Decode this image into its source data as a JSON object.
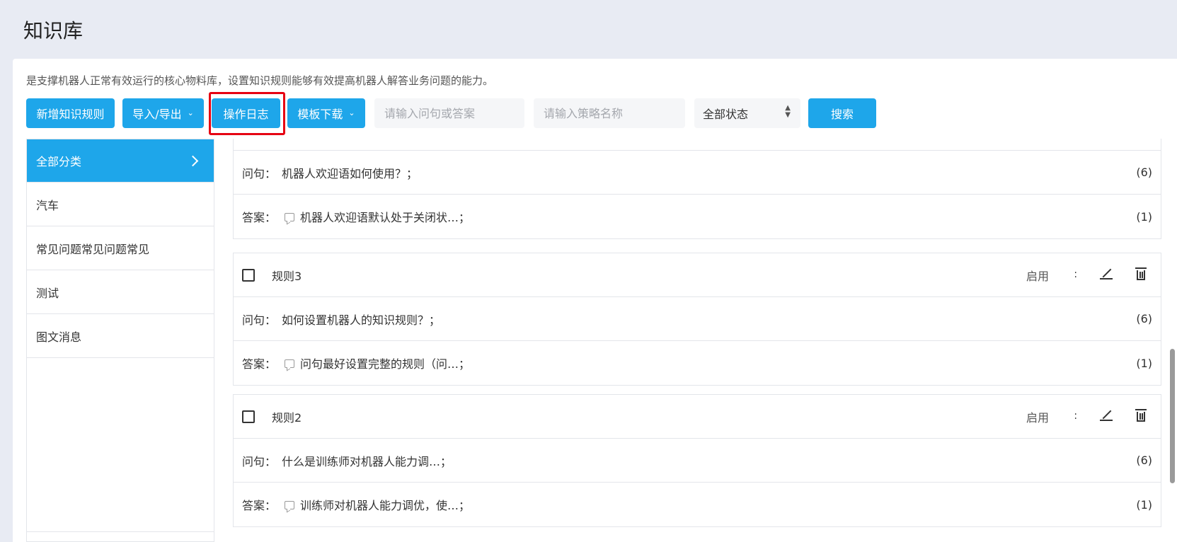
{
  "page": {
    "title": "知识库",
    "description": "是支撑机器人正常有效运行的核心物料库，设置知识规则能够有效提高机器人解答业务问题的能力。"
  },
  "toolbar": {
    "add_rule": "新增知识规则",
    "import_export": "导入/导出",
    "op_log": "操作日志",
    "template_download": "模板下载",
    "search_question_placeholder": "请输入问句或答案",
    "search_strategy_placeholder": "请输入策略名称",
    "status_select": "全部状态",
    "search": "搜索"
  },
  "sidebar": {
    "items": [
      {
        "label": "全部分类"
      },
      {
        "label": "汽车"
      },
      {
        "label": "常见问题常见问题常见"
      },
      {
        "label": "测试"
      },
      {
        "label": "图文消息"
      }
    ]
  },
  "labels": {
    "question": "问句：",
    "answer": "答案："
  },
  "rules": [
    {
      "name": "",
      "question": "机器人欢迎语如何使用？；",
      "question_count": "(6)",
      "answer": "机器人欢迎语默认处于关闭状…；",
      "answer_count": "(1)"
    },
    {
      "name": "规则3",
      "status": "启用",
      "question": "如何设置机器人的知识规则？；",
      "question_count": "(6)",
      "answer": "问句最好设置完整的规则（问…；",
      "answer_count": "(1)"
    },
    {
      "name": "规则2",
      "status": "启用",
      "question": "什么是训练师对机器人能力调…；",
      "question_count": "(6)",
      "answer": "训练师对机器人能力调优，使…；",
      "answer_count": "(1)"
    }
  ],
  "colors": {
    "accent": "#1ea6ea",
    "highlight": "#e60012"
  }
}
